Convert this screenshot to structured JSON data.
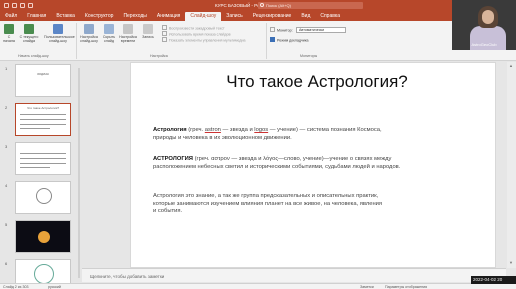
{
  "window": {
    "doc_title": "КУРС БАЗОВЫЙ - PowerPoint",
    "search_placeholder": "Поиск (Alt+Q)"
  },
  "menu": {
    "tabs": [
      "Файл",
      "Главная",
      "Вставка",
      "Конструктор",
      "Переходы",
      "Анимация",
      "Слайд-шоу",
      "Запись",
      "Рецензирование",
      "Вид",
      "Справка"
    ],
    "active_index": 6
  },
  "ribbon": {
    "buttons": [
      {
        "label": "С начала",
        "icon": "play-icon"
      },
      {
        "label": "С текущего слайда",
        "icon": "play-current-icon"
      },
      {
        "label": "Пользовательское слайд-шоу",
        "icon": "custom-show-icon"
      },
      {
        "label": "Настройка слайд-шоу",
        "icon": "setup-icon"
      },
      {
        "label": "Скрыть слайд",
        "icon": "hide-slide-icon"
      },
      {
        "label": "Настройка времени",
        "icon": "timer-icon"
      },
      {
        "label": "Запись",
        "icon": "record-icon"
      }
    ],
    "checkboxes": [
      {
        "label": "Воспроизвести закадровый текст",
        "checked": false
      },
      {
        "label": "Использовать время показа слайдов",
        "checked": false
      },
      {
        "label": "Показать элементы управления мультимедиа",
        "checked": false
      }
    ],
    "groups": [
      "Начать слайд-шоу",
      "Настройка",
      "Мониторы"
    ],
    "monitor_label": "Монитор:",
    "monitor_value": "Автоматически",
    "presenter_view": {
      "label": "Режим докладчика",
      "checked": true
    }
  },
  "thumbnails": [
    {
      "num": "1",
      "selected": false,
      "title": "ЗОДИАК"
    },
    {
      "num": "2",
      "selected": true,
      "title": "Что такое Астрология?"
    },
    {
      "num": "3",
      "selected": false,
      "title": ""
    },
    {
      "num": "4",
      "selected": false,
      "title": ""
    },
    {
      "num": "5",
      "selected": false,
      "title": ""
    },
    {
      "num": "6",
      "selected": false,
      "title": ""
    }
  ],
  "slide": {
    "title": "Что такое Астрология?",
    "p1_term": "Астрология",
    "p1_a": " (греч. ",
    "p1_w1": "astron",
    "p1_b": " — звезда и ",
    "p1_w2": "logos",
    "p1_c": " — учение) —  система познания Космоса,",
    "p1_line2": "природы и человека в их эволюционном движении.",
    "p2_term": "АСТРОЛОГИЯ",
    "p2_rest": " (греч. αστρον — звезда и λόγος—слово, учение)—учение о связях между",
    "p2_line2": "расположением небесных светил и историческими событиями, судьбами людей и народов.",
    "p3_line1": "Астрология это знание, а так же группа предсказательных и описательных практик,",
    "p3_line2": "которые занимаются изучением влияния планет на все живое, на человека,  явления",
    "p3_line3": "и события."
  },
  "notes_placeholder": "Щелкните, чтобы добавить заметки",
  "status": {
    "slide_info": "Слайд 2 из 303",
    "language": "русский",
    "notes_button": "Заметки",
    "display_settings": "Параметры отображения"
  },
  "webcam": {
    "label": "AstroGeoClub"
  },
  "timestamp": "2022-04-02 20"
}
